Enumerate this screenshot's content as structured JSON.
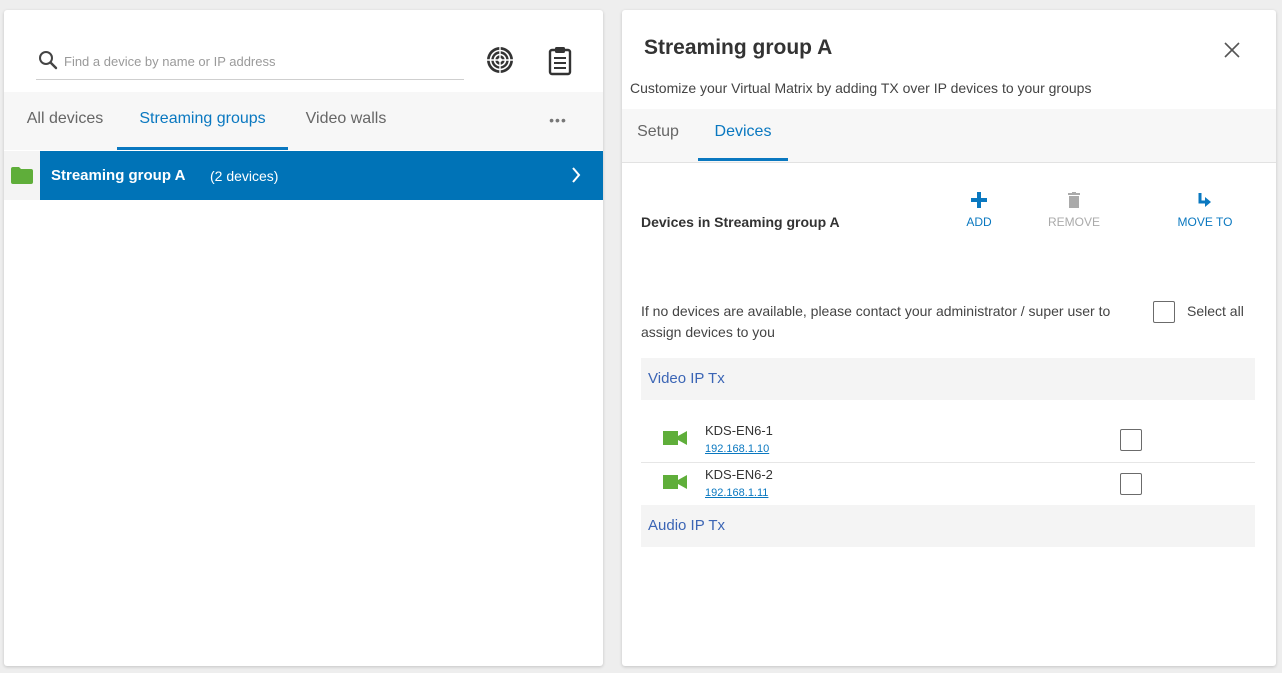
{
  "left": {
    "search": {
      "placeholder": "Find a device by name or IP address",
      "value": ""
    },
    "tabs": [
      {
        "label": "All devices",
        "active": false
      },
      {
        "label": "Streaming groups",
        "active": true
      },
      {
        "label": "Video walls",
        "active": false
      }
    ],
    "more_label": "•••",
    "groups": [
      {
        "name": "Streaming group A",
        "count": "(2 devices)",
        "selected": true
      }
    ]
  },
  "right": {
    "title": "Streaming group A",
    "subtitle": "Customize your Virtual Matrix by adding TX over IP devices to your groups",
    "tabs": [
      {
        "label": "Setup",
        "active": false
      },
      {
        "label": "Devices",
        "active": true
      }
    ],
    "devices_heading": "Devices in Streaming group A",
    "actions": {
      "add": "ADD",
      "remove": "REMOVE",
      "move_to": "MOVE TO"
    },
    "info": "If no devices are available, please contact your administrator / super user to assign devices to you",
    "select_all": "Select all",
    "categories": [
      {
        "name": "Video IP Tx",
        "devices": [
          {
            "name": "KDS-EN6-1",
            "ip": "192.168.1.10",
            "checked": false
          },
          {
            "name": "KDS-EN6-2",
            "ip": "192.168.1.11",
            "checked": false
          }
        ]
      },
      {
        "name": "Audio IP Tx",
        "devices": []
      }
    ]
  },
  "icons": {
    "search": "search-icon",
    "radar": "radar-icon",
    "clipboard": "clipboard-icon",
    "folder": "folder-icon",
    "chevron": "chevron-right-icon",
    "close": "close-icon",
    "add": "plus-icon",
    "remove": "trash-icon",
    "move": "move-arrow-icon",
    "camera": "video-camera-icon"
  },
  "colors": {
    "accent": "#0a78c0",
    "selected_row": "#0073b7",
    "folder_green": "#5fae3a",
    "category_text": "#3b65b5"
  }
}
